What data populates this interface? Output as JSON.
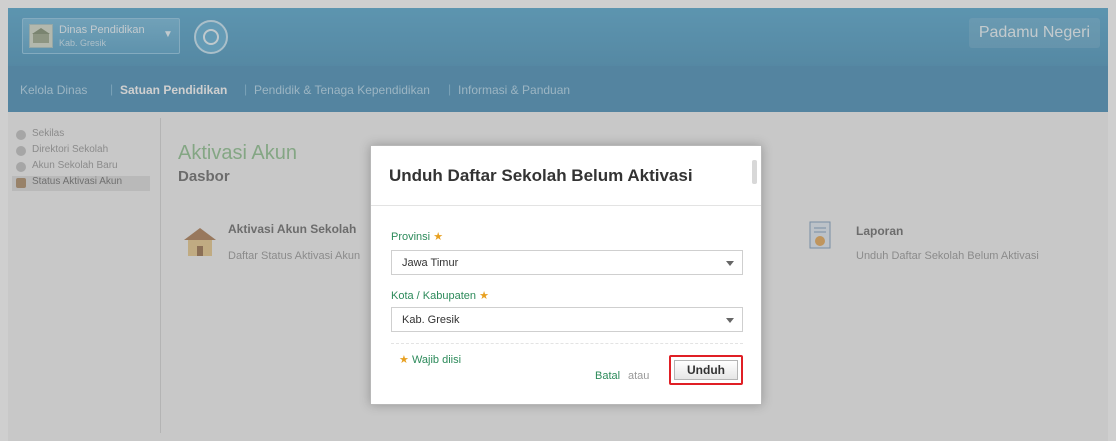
{
  "header": {
    "org_name": "Dinas Pendidikan",
    "org_sub": "Kab. Gresik",
    "brand": "Padamu Negeri"
  },
  "nav": {
    "items": [
      "Kelola Dinas",
      "Satuan Pendidikan",
      "Pendidik & Tenaga Kependidikan",
      "Informasi & Panduan"
    ],
    "separators": [
      "|",
      "|",
      "|"
    ]
  },
  "sidebar": {
    "items": [
      "Sekilas",
      "Direktori Sekolah",
      "Akun Sekolah Baru",
      "Status Aktivasi Akun"
    ]
  },
  "main": {
    "title": "Aktivasi Akun",
    "subtitle": "Dasbor",
    "cards": [
      {
        "title": "Aktivasi Akun Sekolah",
        "link": "Daftar Status Aktivasi Akun"
      },
      {
        "title": "Laporan",
        "link": "Unduh Daftar Sekolah Belum Aktivasi"
      }
    ]
  },
  "modal": {
    "title": "Unduh Daftar Sekolah Belum Aktivasi",
    "provinsi_label": "Provinsi",
    "provinsi_value": "Jawa Timur",
    "kota_label": "Kota / Kabupaten",
    "kota_value": "Kab. Gresik",
    "required_mark": "★",
    "required_note": "Wajib diisi",
    "cancel": "Batal",
    "or": "atau",
    "submit": "Unduh"
  },
  "colors": {
    "topbar": "#3b9bc9",
    "navbar": "#2b7fae",
    "accent_green": "#2c8a5a",
    "required_star": "#e8a020",
    "highlight_red": "#e01f25"
  },
  "icons": {
    "org_logo": "school-emblem-icon",
    "home": "circle-home-icon",
    "sidebar": [
      "info-icon",
      "directory-icon",
      "new-account-icon",
      "status-icon"
    ],
    "card_school": "school-house-icon",
    "card_report": "report-document-icon"
  }
}
